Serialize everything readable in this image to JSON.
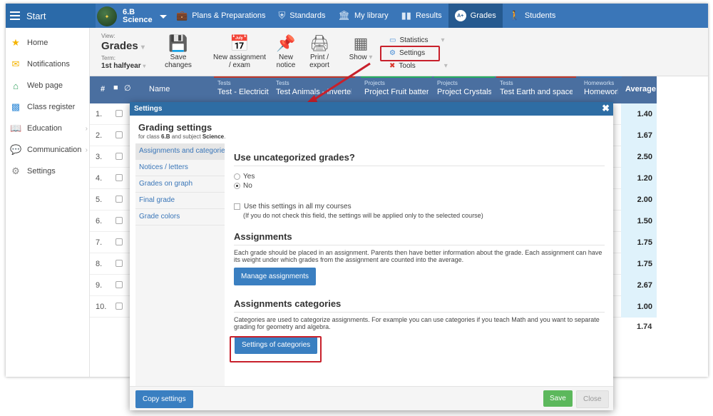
{
  "topbar": {
    "start_label": "Start",
    "class_line1": "6.B",
    "class_line2": "Science",
    "nav": [
      {
        "label": "Plans & Preparations",
        "icon": "briefcase-icon"
      },
      {
        "label": "Standards",
        "icon": "shield-icon"
      },
      {
        "label": "My library",
        "icon": "library-icon"
      },
      {
        "label": "Results",
        "icon": "bar-chart-icon"
      },
      {
        "label": "Grades",
        "icon": "grades-icon",
        "active": true
      },
      {
        "label": "Students",
        "icon": "students-icon"
      }
    ]
  },
  "sidebar": {
    "items": [
      {
        "label": "Home",
        "icon": "star-icon"
      },
      {
        "label": "Notifications",
        "icon": "envelope-icon"
      },
      {
        "label": "Web page",
        "icon": "home-icon"
      },
      {
        "label": "Class register",
        "icon": "book-icon"
      },
      {
        "label": "Education",
        "icon": "education-icon"
      },
      {
        "label": "Communication",
        "icon": "chat-icon"
      },
      {
        "label": "Settings",
        "icon": "gear-icon"
      }
    ]
  },
  "toolbar": {
    "view_label": "View:",
    "view_value": "Grades",
    "term_label": "Term:",
    "term_value": "1st halfyear",
    "save_line1": "Save",
    "save_line2": "changes",
    "new_assignment_line1": "New assignment",
    "new_assignment_line2": "/ exam",
    "new_notice_line1": "New",
    "new_notice_line2": "notice",
    "print_line1": "Print /",
    "print_line2": "export",
    "show_label": "Show",
    "statistics_label": "Statistics",
    "settings_label": "Settings",
    "tools_label": "Tools"
  },
  "grid": {
    "col_num": "#",
    "col_name": "Name",
    "col_average": "Average",
    "columns": [
      {
        "category": "Tests",
        "name": "Test - Electricity",
        "color": "#c0392b"
      },
      {
        "category": "Tests",
        "name": "Test Animals - Invertebrates",
        "color": "#c0392b"
      },
      {
        "category": "Projects",
        "name": "Project Fruit battery",
        "color": "#27ae60"
      },
      {
        "category": "Projects",
        "name": "Project Crystals",
        "color": "#27ae60"
      },
      {
        "category": "Tests",
        "name": "Test Earth and space",
        "color": "#c0392b"
      },
      {
        "category": "Homeworks",
        "name": "Homework",
        "color": "#3a76b8"
      }
    ],
    "rows": [
      {
        "num": "1.",
        "average": "1.40"
      },
      {
        "num": "2.",
        "average": "1.67"
      },
      {
        "num": "3.",
        "average": "2.50"
      },
      {
        "num": "4.",
        "average": "1.20"
      },
      {
        "num": "5.",
        "average": "2.00"
      },
      {
        "num": "6.",
        "average": "1.50"
      },
      {
        "num": "7.",
        "average": "1.75"
      },
      {
        "num": "8.",
        "average": "1.75"
      },
      {
        "num": "9.",
        "average": "2.67"
      },
      {
        "num": "10.",
        "average": "1.00"
      }
    ],
    "total_average": "1.74"
  },
  "modal": {
    "header_title": "Settings",
    "title": "Grading settings",
    "subtitle_prefix": "for class ",
    "subtitle_class": "6.B",
    "subtitle_mid": " and subject ",
    "subtitle_subject": "Science",
    "subtitle_end": ".",
    "nav": [
      {
        "label": "Assignments and categories"
      },
      {
        "label": "Notices / letters"
      },
      {
        "label": "Grades on graph"
      },
      {
        "label": "Final grade"
      },
      {
        "label": "Grade colors"
      }
    ],
    "uncategorized_title": "Use uncategorized grades?",
    "opt_yes": "Yes",
    "opt_no": "No",
    "use_all_label": "Use this settings in all my courses",
    "use_all_note": "(If you do not check this field, the settings will be applied only to the selected course)",
    "assignments_title": "Assignments",
    "assignments_desc": "Each grade should be placed in an assignment. Parents then have better information about the grade. Each assignment can have its weight under which grades from the assignment are counted into the average.",
    "manage_btn": "Manage assignments",
    "categories_title": "Assignments categories",
    "categories_desc": "Categories are used to categorize assignments. For example you can use categories if you teach Math and you want to separate grading for geometry and algebra.",
    "categories_btn": "Settings of categories",
    "copy_btn": "Copy settings",
    "save_btn": "Save",
    "close_btn": "Close"
  },
  "colors": {
    "topbar": "#3a76b8",
    "highlight": "#c8202b",
    "save_green": "#5cb85c"
  }
}
